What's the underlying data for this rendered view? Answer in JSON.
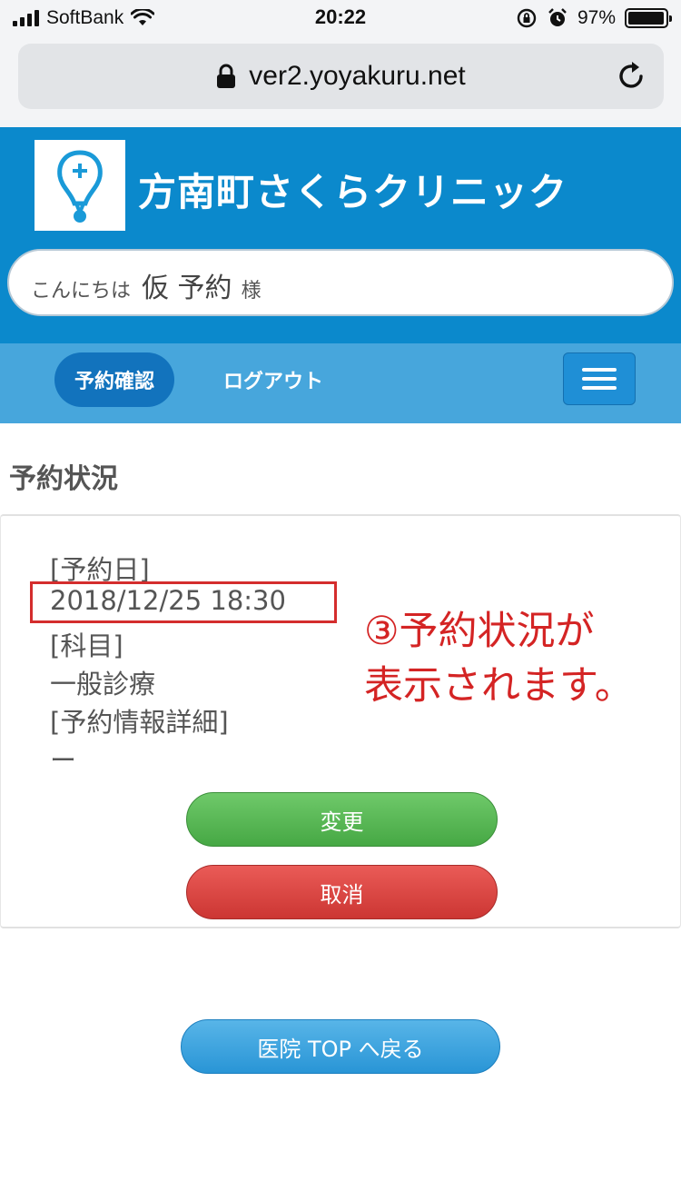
{
  "status_bar": {
    "carrier": "SoftBank",
    "time": "20:22",
    "battery_text": "97%",
    "battery_level_percent": 97
  },
  "browser": {
    "url": "ver2.yoyakuru.net"
  },
  "header": {
    "clinic_name": "方南町さくらクリニック",
    "greeting_prefix": "こんにちは",
    "user_name": "仮 予約",
    "greeting_suffix": "様"
  },
  "nav": {
    "reservation_confirm": "予約確認",
    "logout": "ログアウト"
  },
  "section": {
    "title": "予約状況"
  },
  "reservation": {
    "date_label": "[予約日]",
    "date_value": "2018/12/25 18:30",
    "subject_label": "[科目]",
    "subject_value": "一般診療",
    "detail_label": "[予約情報詳細]",
    "detail_value": "ー"
  },
  "buttons": {
    "change": "変更",
    "cancel": "取消",
    "clinic_top": "医院 TOP へ戻る"
  },
  "annotation": {
    "line1": "③予約状況が",
    "line2": "表示されます。"
  },
  "colors": {
    "header_blue": "#0b89cc",
    "nav_blue": "#47a6dc",
    "active_pill": "#1273bd",
    "change_green": "#46a844",
    "cancel_red": "#cc3633",
    "annotation_red": "#d42424"
  }
}
